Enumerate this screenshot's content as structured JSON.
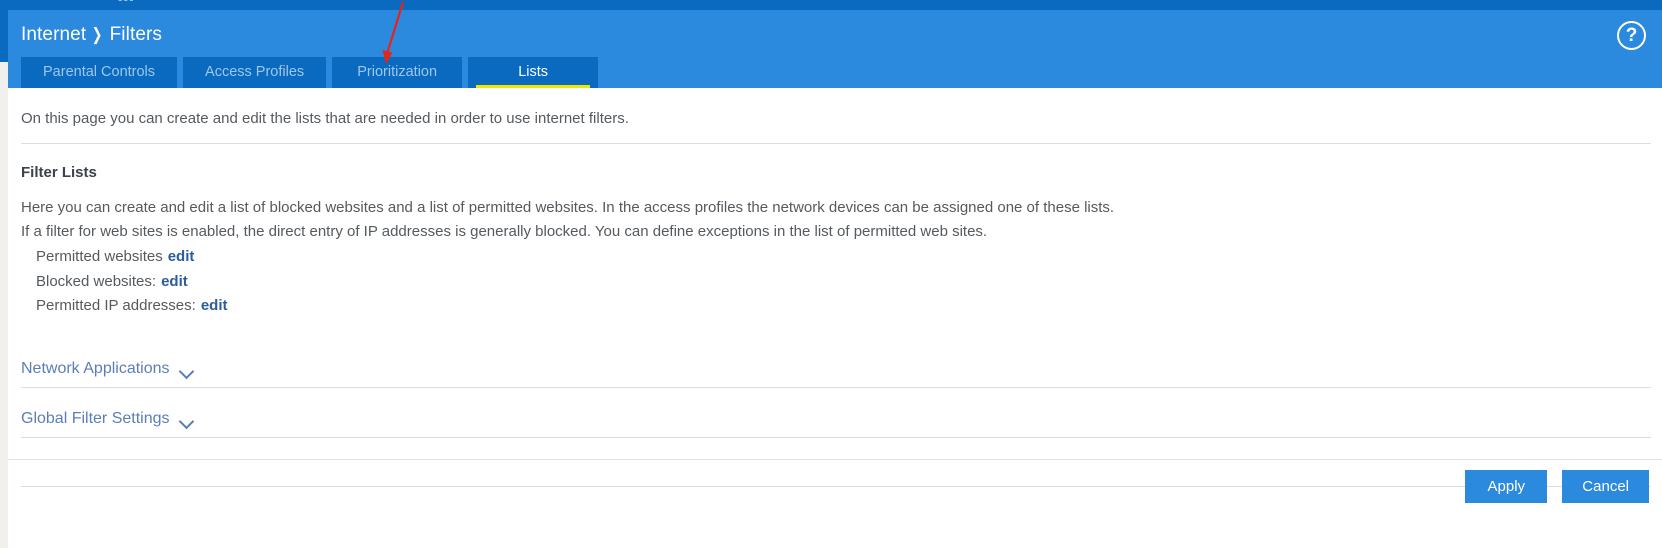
{
  "top_chrome": {
    "partial_text": "· · ·  ▪▪▪ ·"
  },
  "header": {
    "breadcrumb": {
      "root": "Internet",
      "separator": "❯",
      "current": "Filters"
    },
    "help_icon_label": "?",
    "bg_color": "#2b8ade"
  },
  "tabs": [
    {
      "label": "Parental Controls",
      "active": false
    },
    {
      "label": "Access Profiles",
      "active": false
    },
    {
      "label": "Prioritization",
      "active": false
    },
    {
      "label": "Lists",
      "active": true
    }
  ],
  "tab_colors": {
    "bg": "#0a6ac0",
    "inactive_text": "#9dc7ea",
    "active_text": "#ffffff",
    "active_underline": "#f2e500"
  },
  "main": {
    "intro": "On this page you can create and edit the lists that are needed in order to use internet filters.",
    "section_title": "Filter Lists",
    "body_line_1": "Here you can create and edit a list of blocked websites and a list of permitted websites. In the access profiles the network devices can be assigned one of these lists.",
    "body_line_2": "If a filter for web sites is enabled, the direct entry of IP addresses is generally blocked. You can define exceptions in the list of permitted web sites.",
    "list_rows": [
      {
        "label": "Permitted websites",
        "link": "edit"
      },
      {
        "label": "Blocked websites:",
        "link": "edit"
      },
      {
        "label": "Permitted IP addresses:",
        "link": "edit"
      }
    ],
    "collapsibles": [
      {
        "label": "Network Applications",
        "icon": "chevron-down-icon",
        "expanded": false
      },
      {
        "label": "Global Filter Settings",
        "icon": "chevron-down-icon",
        "expanded": false
      }
    ],
    "link_color": "#2c5d9b",
    "collapsible_color": "#5b7fb5"
  },
  "footer": {
    "apply_label": "Apply",
    "cancel_label": "Cancel",
    "button_color": "#2b8ade"
  },
  "annotation": {
    "arrow_color": "#e8231a",
    "points_at": "Prioritization"
  }
}
